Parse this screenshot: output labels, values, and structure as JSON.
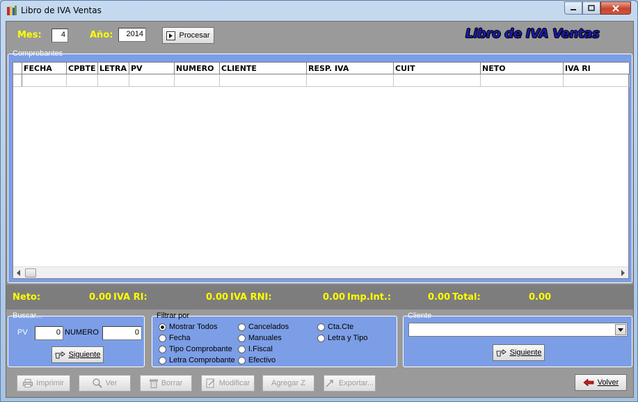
{
  "window": {
    "title": "Libro de IVA Ventas"
  },
  "top": {
    "mes_label": "Mes:",
    "mes_value": "4",
    "anio_label": "Año:",
    "anio_value": "2014",
    "procesar_label": "Procesar",
    "banner": "Libro de IVA Ventas"
  },
  "comprobantes": {
    "group_title": "Comprobantes",
    "columns": [
      "FECHA",
      "CPBTE",
      "LETRA",
      "PV",
      "NUMERO",
      "CLIENTE",
      "RESP. IVA",
      "CUIT",
      "NETO",
      "IVA RI"
    ]
  },
  "totals": {
    "neto_label": "Neto:",
    "neto_value": "0.00",
    "iva_ri_label": "IVA RI:",
    "iva_ri_value": "0.00",
    "iva_rni_label": "IVA RNI:",
    "iva_rni_value": "0.00",
    "imp_int_label": "Imp.Int.:",
    "imp_int_value": "0.00",
    "total_label": "Total:",
    "total_value": "0.00"
  },
  "buscar": {
    "group_title": "Buscar...",
    "pv_label": "PV",
    "pv_value": "0",
    "numero_label": "NUMERO",
    "numero_value": "0",
    "siguiente_label": "Siguiente"
  },
  "filtrar": {
    "group_title": "Filtrar por",
    "options": [
      "Mostrar Todos",
      "Fecha",
      "Tipo Comprobante",
      "Letra Comprobante",
      "Cancelados",
      "Manuales",
      "I.Fiscal",
      "Efectivo",
      "Cta.Cte",
      "Letra y Tipo"
    ],
    "selected": "Mostrar Todos"
  },
  "cliente": {
    "group_title": "Cliente",
    "combo_value": "",
    "siguiente_label": "Siguiente"
  },
  "toolbar": {
    "imprimir": "Imprimir",
    "ver": "Ver",
    "borrar": "Borrar",
    "modificar": "Modificar",
    "agregar_z": "Agregar Z",
    "exportar": "Exportar...",
    "volver": "Volver"
  }
}
